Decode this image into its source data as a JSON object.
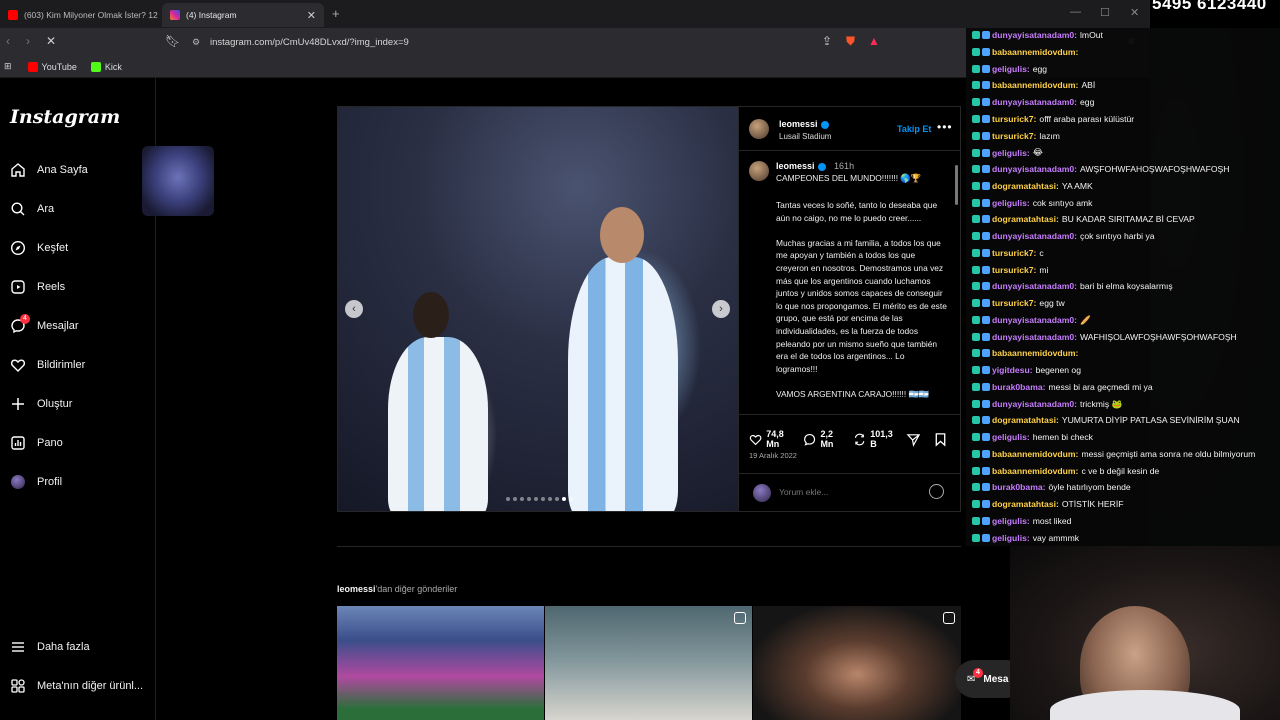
{
  "browser": {
    "tabs": [
      {
        "title": "(603) Kim Milyoner Olmak İster? 120...",
        "active": false,
        "favicon_color": "#ff0000"
      },
      {
        "title": "(4) Instagram",
        "active": true,
        "favicon_color": "#d6249f"
      }
    ],
    "url": "instagram.com/p/CmUv48DLvxd/?img_index=9",
    "bookmarks": [
      {
        "label": "YouTube",
        "color": "#ff0000"
      },
      {
        "label": "Kick",
        "color": "#53fc18"
      }
    ]
  },
  "instagram": {
    "logo": "Instagram",
    "nav": [
      {
        "label": "Ana Sayfa",
        "icon": "home-icon"
      },
      {
        "label": "Ara",
        "icon": "search-icon"
      },
      {
        "label": "Keşfet",
        "icon": "compass-icon"
      },
      {
        "label": "Reels",
        "icon": "reels-icon"
      },
      {
        "label": "Mesajlar",
        "icon": "messenger-icon",
        "badge": "4"
      },
      {
        "label": "Bildirimler",
        "icon": "heart-icon"
      },
      {
        "label": "Oluştur",
        "icon": "plus-icon"
      },
      {
        "label": "Pano",
        "icon": "dashboard-icon"
      },
      {
        "label": "Profil",
        "icon": "avatar-icon"
      }
    ],
    "bottom_nav": [
      {
        "label": "Daha fazla",
        "icon": "menu-icon"
      },
      {
        "label": "Meta'nın diğer ürünl...",
        "icon": "meta-apps-icon"
      }
    ],
    "post": {
      "username": "leomessi",
      "location": "Lusail Stadium",
      "follow_label": "Takip Et",
      "caption_time": "161h",
      "caption_title": "CAMPEONES DEL MUNDO!!!!!!! 🌎🏆",
      "caption_paragraphs": [
        "Tantas veces lo soñé, tanto lo deseaba que aún no caigo, no me lo puedo creer......",
        "Muchas gracias a mi familia, a todos los que me apoyan y también a todos los que creyeron en nosotros. Demostramos una vez más que los argentinos cuando luchamos juntos y unidos somos capaces de conseguir lo que nos propongamos. El mérito es de este grupo, que está por encima de las individualidades, es la fuerza de todos peleando por un mismo sueño que también era el de todos los argentinos... Lo logramos!!!",
        "VAMOS ARGENTINA CARAJO!!!!!! 🇦🇷🇦🇷"
      ],
      "likes": "74,8 Mn",
      "comments": "2,2 Mn",
      "reposts": "101,3 B",
      "date": "19 Aralık 2022",
      "comment_placeholder": "Yorum ekle...",
      "carousel_dots": 10,
      "carousel_active": 9
    },
    "more_from": {
      "user": "leomessi",
      "suffix": "'dan diğer gönderiler"
    },
    "messages_pill": {
      "label": "Mesa",
      "badge": "4"
    }
  },
  "overlay": {
    "phone": "5495 6123440",
    "chat": [
      {
        "user": "dunyayisatanadam0",
        "msg": "lmOut",
        "color": "#c77dff"
      },
      {
        "user": "babaannemidovdum",
        "msg": "",
        "color": "#ffd24a"
      },
      {
        "user": "geligulis",
        "msg": "egg",
        "color": "#c77dff"
      },
      {
        "user": "babaannemidovdum",
        "msg": "ABİ",
        "color": "#ffd24a"
      },
      {
        "user": "dunyayisatanadam0",
        "msg": "egg",
        "color": "#c77dff"
      },
      {
        "user": "tursurick7",
        "msg": "offf araba parası külüstür",
        "color": "#ffd24a"
      },
      {
        "user": "tursurick7",
        "msg": "lazım",
        "color": "#ffd24a"
      },
      {
        "user": "geligulis",
        "msg": "😂",
        "color": "#c77dff"
      },
      {
        "user": "dunyayisatanadam0",
        "msg": "AWŞFOHWFAHOŞWAFOŞHWAFOŞH",
        "color": "#c77dff"
      },
      {
        "user": "dogramatahtasi",
        "msg": "YA AMK",
        "color": "#ffd24a"
      },
      {
        "user": "geligulis",
        "msg": "cok sıntıyo amk",
        "color": "#c77dff"
      },
      {
        "user": "dogramatahtasi",
        "msg": "BU KADAR SIRITAMAZ Bİ CEVAP",
        "color": "#ffd24a"
      },
      {
        "user": "dunyayisatanadam0",
        "msg": "çok sırıtıyo harbi ya",
        "color": "#c77dff"
      },
      {
        "user": "tursurick7",
        "msg": "c",
        "color": "#ffd24a"
      },
      {
        "user": "tursurick7",
        "msg": "mi",
        "color": "#ffd24a"
      },
      {
        "user": "dunyayisatanadam0",
        "msg": "bari bi elma koysalarmış",
        "color": "#c77dff"
      },
      {
        "user": "tursurick7",
        "msg": "egg tw",
        "color": "#ffd24a"
      },
      {
        "user": "dunyayisatanadam0",
        "msg": "🥖",
        "color": "#c77dff"
      },
      {
        "user": "dunyayisatanadam0",
        "msg": "WAFHIŞOLAWFOŞHAWFŞOHWAFOŞH",
        "color": "#c77dff"
      },
      {
        "user": "babaannemidovdum",
        "msg": "",
        "color": "#ffd24a"
      },
      {
        "user": "yigitdesu",
        "msg": "begenen og",
        "color": "#c77dff"
      },
      {
        "user": "burak0bama",
        "msg": "messi bi ara geçmedi mi ya",
        "color": "#c77dff"
      },
      {
        "user": "dunyayisatanadam0",
        "msg": "trickmiş 🐸",
        "color": "#c77dff"
      },
      {
        "user": "dogramatahtasi",
        "msg": "YUMURTA DİYİP PATLASA SEVİNİRİM ŞUAN",
        "color": "#ffd24a"
      },
      {
        "user": "geligulis",
        "msg": "hemen bi check",
        "color": "#c77dff"
      },
      {
        "user": "babaannemidovdum",
        "msg": "messi geçmişti ama sonra ne oldu bilmiyorum",
        "color": "#ffd24a"
      },
      {
        "user": "babaannemidovdum",
        "msg": "c ve b değil kesin de",
        "color": "#ffd24a"
      },
      {
        "user": "burak0bama",
        "msg": "öyle hatırlıyom bende",
        "color": "#c77dff"
      },
      {
        "user": "dogramatahtasi",
        "msg": "OTİSTİK HERİF",
        "color": "#ffd24a"
      },
      {
        "user": "geligulis",
        "msg": "most liked",
        "color": "#c77dff"
      },
      {
        "user": "geligulis",
        "msg": "vay ammmk",
        "color": "#c77dff"
      }
    ]
  }
}
